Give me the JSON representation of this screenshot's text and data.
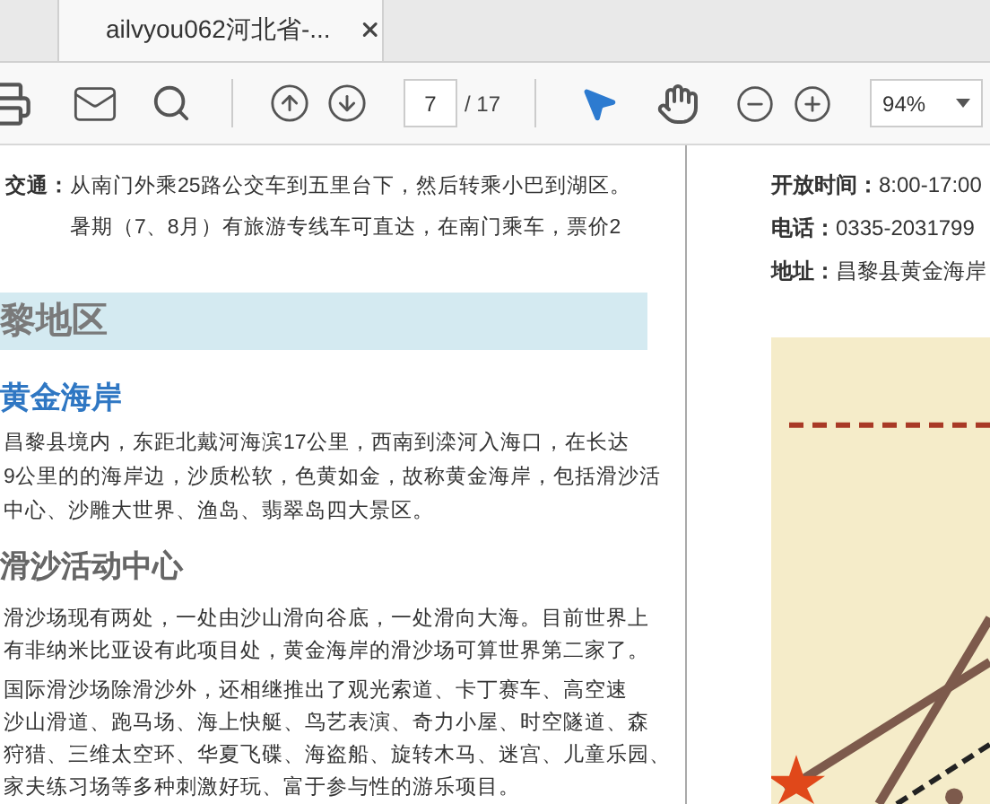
{
  "tabs": [
    {
      "label": "ailvyou062河北省-...",
      "selected": true
    }
  ],
  "toolbar": {
    "page": "7",
    "page_total": "/ 17",
    "tools": [
      {
        "kind": "select",
        "selected": true
      },
      {
        "kind": "hand",
        "selected": false
      }
    ],
    "zoom": "94%"
  },
  "document": {
    "left": {
      "transport": {
        "label": "交通：",
        "lines": [
          "从南门外乘25路公交车到五里台下，然后转乘小巴到湖区。",
          "暑期（7、8月）有旅游专线车可直达，在南门乘车，票价2"
        ]
      },
      "region_heading": "黎地区",
      "section_title": "黄金海岸",
      "section_lines": [
        "昌黎县境内，东距北戴河海滨17公里，西南到滦河入海口，在长达",
        "9公里的的海岸边，沙质松软，色黄如金，故称黄金海岸，包括滑沙活",
        "中心、沙雕大世界、渔岛、翡翠岛四大景区。"
      ],
      "sub_title": "滑沙活动中心",
      "paragraphs": [
        [
          "滑沙场现有两处，一处由沙山滑向谷底，一处滑向大海。目前世界上",
          "有非纳米比亚设有此项目处，黄金海岸的滑沙场可算世界第二家了。"
        ],
        [
          "国际滑沙场除滑沙外，还相继推出了观光索道、卡丁赛车、高空速",
          "沙山滑道、跑马场、海上快艇、鸟艺表演、奇力小屋、时空隧道、森",
          "狩猎、三维太空环、华夏飞碟、海盗船、旋转木马、迷宫、儿童乐园、",
          "家夫练习场等多种刺激好玩、富于参与性的游乐项目。"
        ]
      ]
    },
    "right": {
      "info": [
        {
          "label": "开放时间：",
          "value": "8:00-17:00"
        },
        {
          "label": "电话：",
          "value": "0335-2031799"
        },
        {
          "label": "地址：",
          "value": "昌黎县黄金海岸"
        }
      ]
    }
  }
}
